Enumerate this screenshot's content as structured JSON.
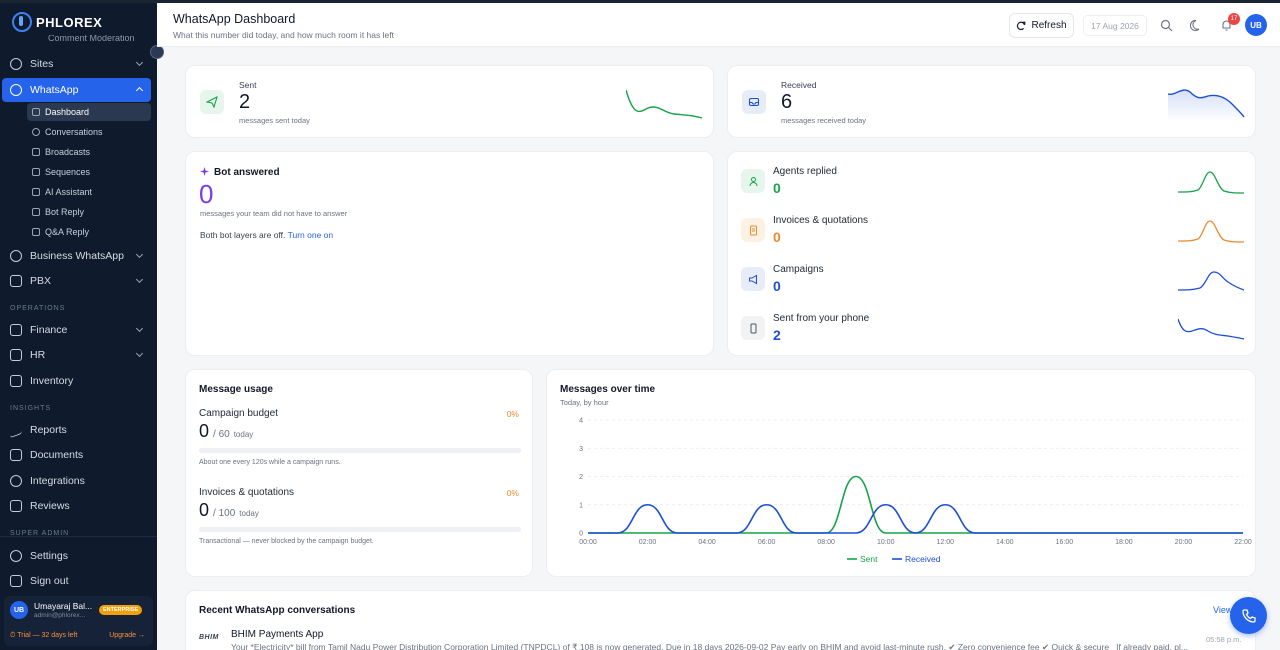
{
  "sidebar": {
    "logo_text": "PHLOREX",
    "clipped_item": "Comment Moderation",
    "items": [
      {
        "label": "Sites"
      },
      {
        "label": "WhatsApp"
      },
      {
        "label": "Business WhatsApp"
      },
      {
        "label": "PBX"
      },
      {
        "label": "Finance"
      },
      {
        "label": "HR"
      },
      {
        "label": "Inventory"
      },
      {
        "label": "Reports"
      },
      {
        "label": "Documents"
      },
      {
        "label": "Integrations"
      },
      {
        "label": "Reviews"
      },
      {
        "label": "Settings"
      },
      {
        "label": "Sign out"
      }
    ],
    "whatsapp_sub": [
      {
        "label": "Dashboard"
      },
      {
        "label": "Conversations"
      },
      {
        "label": "Broadcasts"
      },
      {
        "label": "Sequences"
      },
      {
        "label": "AI Assistant"
      },
      {
        "label": "Bot Reply"
      },
      {
        "label": "Q&A Reply"
      }
    ],
    "sections": {
      "operations": "OPERATIONS",
      "insights": "INSIGHTS",
      "super_admin": "SUPER ADMIN"
    },
    "user": {
      "initials": "UB",
      "name": "Umayaraj Bal...",
      "email": "admin@phlorex...",
      "plan": "ENTERPRISE",
      "trial": "⏱ Trial — 32 days left",
      "upgrade": "Upgrade →"
    }
  },
  "header": {
    "title": "WhatsApp Dashboard",
    "subtitle": "What this number did today, and how much room it has left",
    "refresh_label": "Refresh",
    "date": "17 Aug 2026",
    "notif_count": "17",
    "avatar": "UB"
  },
  "sent_card": {
    "label": "Sent",
    "value": "2",
    "note": "messages sent today"
  },
  "received_card": {
    "label": "Received",
    "value": "6",
    "note": "messages received today"
  },
  "bot_card": {
    "title": "Bot answered",
    "value": "0",
    "note": "messages your team did not have to answer",
    "status": "Both bot layers are off.",
    "link": "Turn one on"
  },
  "breakdown": [
    {
      "label": "Agents replied",
      "value": "0"
    },
    {
      "label": "Invoices & quotations",
      "value": "0"
    },
    {
      "label": "Campaigns",
      "value": "0"
    },
    {
      "label": "Sent from your phone",
      "value": "2"
    }
  ],
  "usage": {
    "title": "Message usage",
    "campaign": {
      "label": "Campaign budget",
      "pct": "0%",
      "value": "0",
      "limit": "/ 60",
      "unit": "today",
      "note": "About one every 120s while a campaign runs."
    },
    "invoices": {
      "label": "Invoices & quotations",
      "pct": "0%",
      "value": "0",
      "limit": "/ 100",
      "unit": "today",
      "note": "Transactional — never blocked by the campaign budget."
    }
  },
  "colors": {
    "sent": "#16a34a",
    "received": "#1d4ed8",
    "accent": "#2563eb",
    "orange": "#ea8a2f"
  },
  "chart_data": {
    "type": "line",
    "title": "Messages over time",
    "subtitle": "Today, by hour",
    "x": [
      "00:00",
      "01:00",
      "02:00",
      "03:00",
      "04:00",
      "05:00",
      "06:00",
      "07:00",
      "08:00",
      "09:00",
      "10:00",
      "11:00",
      "12:00",
      "13:00",
      "14:00",
      "15:00",
      "16:00",
      "17:00",
      "18:00",
      "19:00",
      "20:00",
      "21:00",
      "22:00"
    ],
    "x_ticks": [
      "00:00",
      "02:00",
      "04:00",
      "06:00",
      "08:00",
      "10:00",
      "12:00",
      "14:00",
      "16:00",
      "18:00",
      "20:00",
      "22:00"
    ],
    "y_ticks": [
      0,
      1,
      2,
      3,
      4
    ],
    "ylim": [
      0,
      4
    ],
    "series": [
      {
        "name": "Sent",
        "values": [
          0,
          0,
          0,
          0,
          0,
          0,
          0,
          0,
          0,
          2,
          0,
          0,
          0,
          0,
          0,
          0,
          0,
          0,
          0,
          0,
          0,
          0,
          0
        ]
      },
      {
        "name": "Received",
        "values": [
          0,
          0,
          1,
          0,
          0,
          0,
          1,
          0,
          0,
          0,
          1,
          0,
          1,
          0,
          0,
          0,
          0,
          0,
          0,
          0,
          0,
          0,
          0
        ]
      }
    ],
    "legend": "bottom-center"
  },
  "recent": {
    "title": "Recent WhatsApp conversations",
    "view_all": "View",
    "items": [
      {
        "logo": "BHIM",
        "name": "BHIM Payments App",
        "preview": "Your *Electricity* bill from Tamil Nadu Power Distribution Corporation Limited (TNPDCL) of ₹ 108 is now generated. Due in 18 days 2026-09-02 Pay early on BHIM and avoid last-minute rush. ✔ Zero convenience fee ✔ Quick & secure _If already paid, pl...",
        "time": "05:58 p.m."
      }
    ]
  }
}
